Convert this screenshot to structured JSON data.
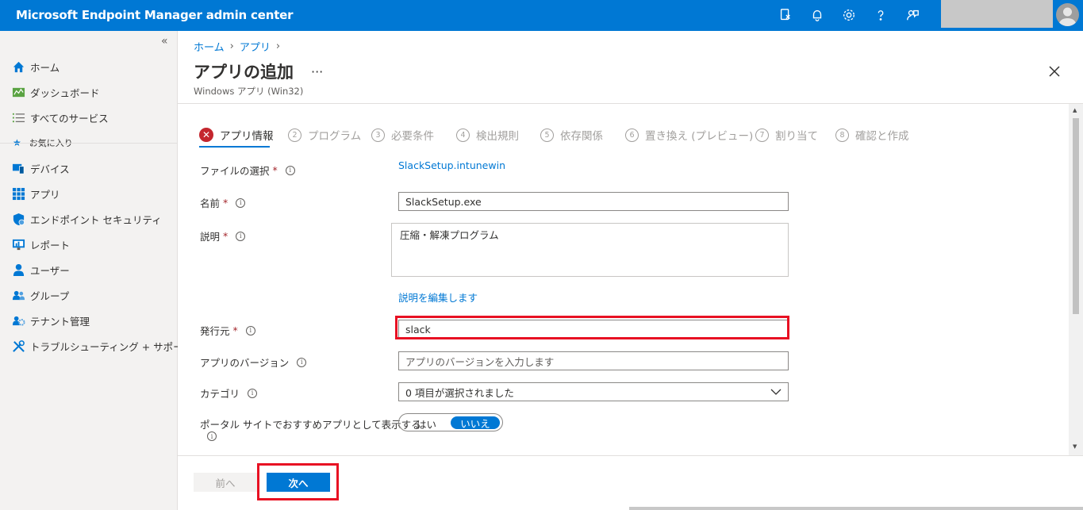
{
  "header": {
    "title": "Microsoft Endpoint Manager admin center",
    "icons": [
      "device-icon",
      "bell-icon",
      "gear-icon",
      "help-icon",
      "feedback-icon"
    ]
  },
  "sidebar": {
    "collapse_label": "«",
    "items": [
      {
        "label": "ホーム",
        "icon": "home-icon"
      },
      {
        "label": "ダッシュボード",
        "icon": "dashboard-icon"
      },
      {
        "label": "すべてのサービス",
        "icon": "list-icon"
      },
      {
        "label": "デバイス",
        "icon": "devices-icon"
      },
      {
        "label": "アプリ",
        "icon": "apps-icon"
      },
      {
        "label": "エンドポイント セキュリティ",
        "icon": "shield-icon"
      },
      {
        "label": "レポート",
        "icon": "report-icon"
      },
      {
        "label": "ユーザー",
        "icon": "user-icon"
      },
      {
        "label": "グループ",
        "icon": "group-icon"
      },
      {
        "label": "テナント管理",
        "icon": "tenant-icon"
      },
      {
        "label": "トラブルシューティング + サポート",
        "icon": "tools-icon"
      }
    ],
    "favorites_label": "お気に入り"
  },
  "breadcrumb": {
    "home": "ホーム",
    "apps": "アプリ",
    "sep": "›"
  },
  "page": {
    "title": "アプリの追加",
    "more": "···",
    "subtitle": "Windows アプリ (Win32)"
  },
  "steps": [
    {
      "num": "✕",
      "label": "アプリ情報",
      "active": true
    },
    {
      "num": "2",
      "label": "プログラム"
    },
    {
      "num": "3",
      "label": "必要条件"
    },
    {
      "num": "4",
      "label": "検出規則"
    },
    {
      "num": "5",
      "label": "依存関係"
    },
    {
      "num": "6",
      "label": "置き換え (プレビュー)"
    },
    {
      "num": "7",
      "label": "割り当て"
    },
    {
      "num": "8",
      "label": "確認と作成"
    }
  ],
  "form": {
    "file_label": "ファイルの選択",
    "file_value": "SlackSetup.intunewin",
    "name_label": "名前",
    "name_value": "SlackSetup.exe",
    "desc_label": "説明",
    "desc_value": "圧縮・解凍プログラム",
    "edit_desc_link": "説明を編集します",
    "publisher_label": "発行元",
    "publisher_value": "slack",
    "version_label": "アプリのバージョン",
    "version_placeholder": "アプリのバージョンを入力します",
    "category_label": "カテゴリ",
    "category_value": "0 項目が選択されました",
    "featured_label": "ポータル サイトでおすすめアプリとして表示する",
    "toggle_yes": "はい",
    "toggle_no": "いいえ",
    "required_mark": "*",
    "info_glyph": "i"
  },
  "footer": {
    "prev": "前へ",
    "next": "次へ"
  },
  "colors": {
    "accent": "#0078d4",
    "highlight": "#e81123",
    "error": "#c4262e"
  }
}
